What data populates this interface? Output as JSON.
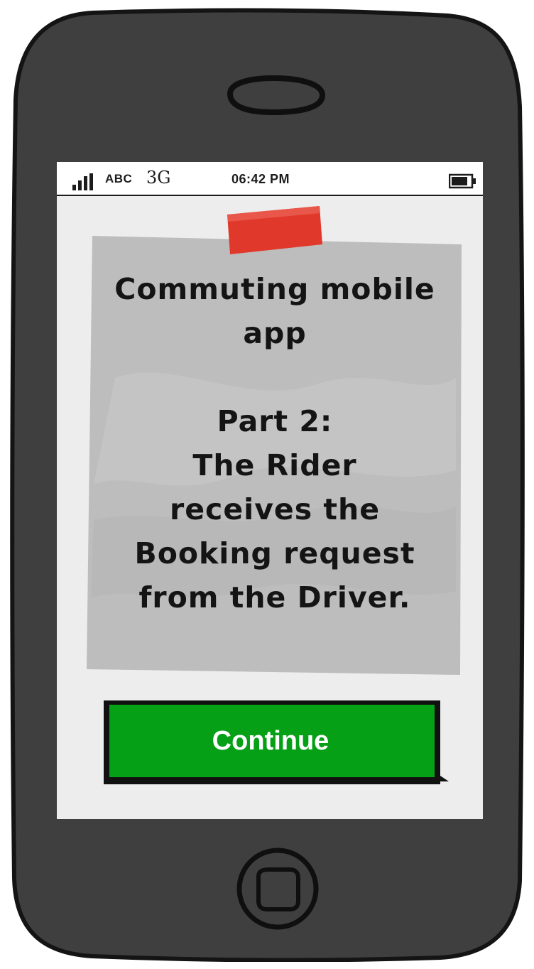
{
  "status_bar": {
    "carrier": "ABC",
    "network": "3G",
    "time": "06:42 PM"
  },
  "note": {
    "lines": [
      "Commuting mobile",
      "app",
      "",
      "Part 2:",
      "The Rider",
      "receives the",
      "Booking request",
      "from the Driver."
    ]
  },
  "continue_button": {
    "label": "Continue"
  },
  "colors": {
    "phone_body": "#3f3f3f",
    "phone_outline": "#141414",
    "screen_bg": "#ededed",
    "note_bg": "#bdbdbd",
    "tape": "#e0392b",
    "button_green": "#06a016",
    "button_border": "#111111"
  },
  "icons": {
    "signal": "signal-bars-icon",
    "battery": "battery-icon",
    "speaker": "speaker-slot-icon",
    "home": "home-button-icon"
  }
}
